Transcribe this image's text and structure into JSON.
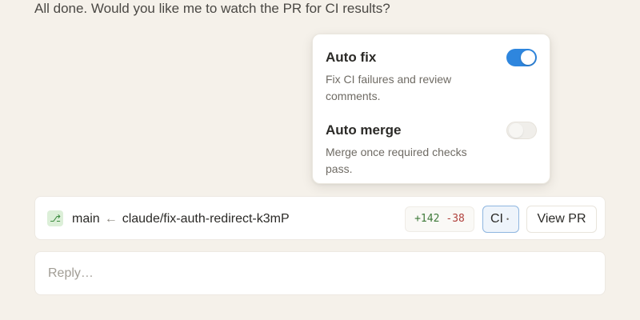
{
  "message": "All done. Would you like me to watch the PR for CI results?",
  "popover": {
    "options": [
      {
        "title": "Auto fix",
        "description": "Fix CI failures and review comments.",
        "enabled": true
      },
      {
        "title": "Auto merge",
        "description": "Merge once required checks pass.",
        "enabled": false
      }
    ]
  },
  "branch_bar": {
    "branch_icon": "git-branch-icon",
    "base_branch": "main",
    "arrow": "←",
    "head_branch": "claude/fix-auth-redirect-k3mP",
    "additions": "+142",
    "deletions": "-38",
    "ci_label": "CI",
    "ci_dot": "•",
    "view_pr_label": "View PR"
  },
  "reply": {
    "placeholder": "Reply…",
    "value": ""
  },
  "colors": {
    "background": "#f5f1ea",
    "toggle_on": "#2e86de",
    "additions": "#3f7a3a",
    "deletions": "#b0413c"
  }
}
